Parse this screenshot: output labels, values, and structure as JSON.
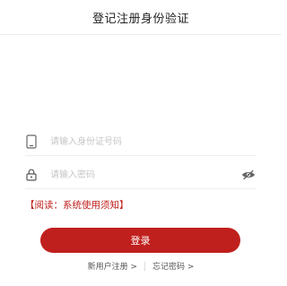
{
  "header": {
    "title": "登记注册身份验证"
  },
  "form": {
    "id_field": {
      "placeholder": "请输入身份证号码",
      "value": "",
      "icon": "phone-icon"
    },
    "password_field": {
      "placeholder": "请输入密码",
      "value": "",
      "icon": "lock-icon",
      "toggle_icon": "eye-hidden-icon"
    },
    "notice": "【阅读：系统使用须知】",
    "login_label": "登录"
  },
  "links": {
    "register": "新用户注册 >",
    "forgot": "忘记密码 >"
  },
  "colors": {
    "accent": "#c0201d",
    "icon_gray": "#666666"
  }
}
